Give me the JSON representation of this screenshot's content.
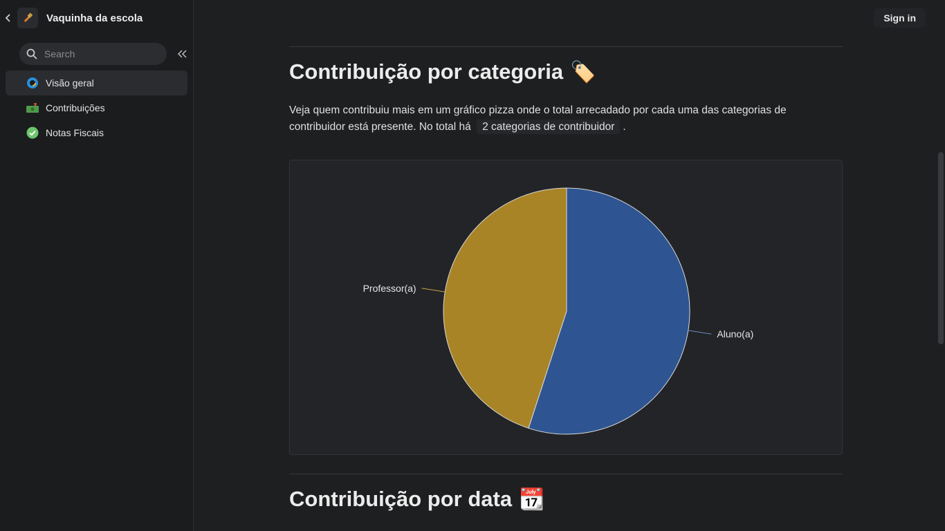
{
  "app": {
    "title": "Vaquinha da escola"
  },
  "search": {
    "placeholder": "Search"
  },
  "nav": {
    "items": [
      {
        "label": "Visão geral",
        "icon": "globe-icon",
        "active": true
      },
      {
        "label": "Contribuições",
        "icon": "money-icon",
        "active": false
      },
      {
        "label": "Notas Fiscais",
        "icon": "check-icon",
        "active": false
      }
    ]
  },
  "header": {
    "sign_in": "Sign in"
  },
  "section1": {
    "title": "Contribuição por categoria",
    "emoji": "🏷️",
    "desc_before": "Veja quem contribuiu mais em um gráfico pizza onde o total arrecadado por cada uma das categorias de contribuidor está presente. No total há",
    "pill": "2 categorias de contribuidor",
    "desc_after": "."
  },
  "section2": {
    "title": "Contribuição por data",
    "emoji": "📆"
  },
  "chart_data": {
    "type": "pie",
    "categories": [
      "Aluno(a)",
      "Professor(a)"
    ],
    "values": [
      55,
      45
    ],
    "colors": [
      "#2e5591",
      "#a88427"
    ]
  }
}
